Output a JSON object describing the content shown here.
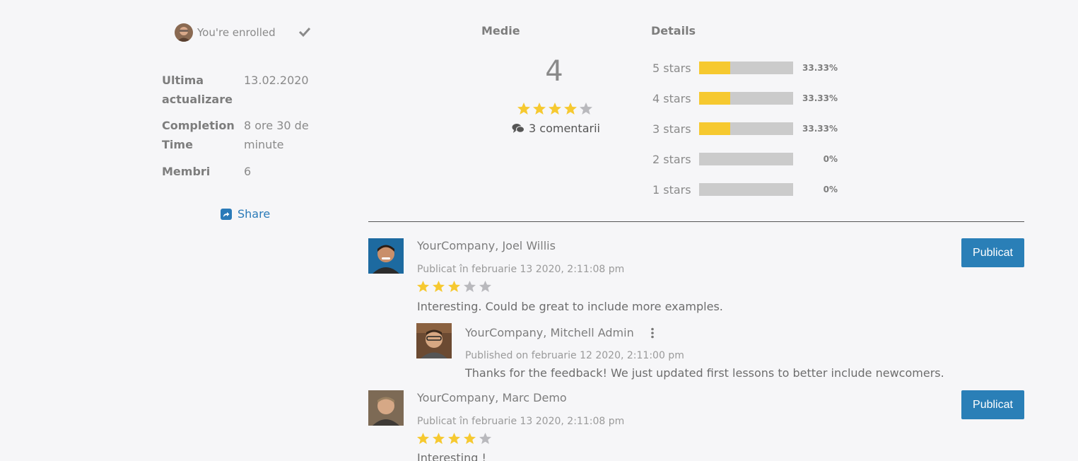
{
  "enrollment": {
    "status_text": "You're enrolled"
  },
  "course_info": [
    {
      "label": "Ultima actualizare",
      "value": "13.02.2020"
    },
    {
      "label": "Completion Time",
      "value": "8 ore 30 de minute"
    },
    {
      "label": "Membri",
      "value": "6"
    }
  ],
  "share": {
    "label": "Share"
  },
  "rating": {
    "average_heading": "Medie",
    "details_heading": "Details",
    "average_value": "4",
    "average_stars": 4,
    "max_stars": 5,
    "comments_text": "3 comentarii",
    "distribution": [
      {
        "label": "5 stars",
        "percent": 33.33,
        "percent_text": "33.33%"
      },
      {
        "label": "4 stars",
        "percent": 33.33,
        "percent_text": "33.33%"
      },
      {
        "label": "3 stars",
        "percent": 33.33,
        "percent_text": "33.33%"
      },
      {
        "label": "2 stars",
        "percent": 0,
        "percent_text": "0%"
      },
      {
        "label": "1 stars",
        "percent": 0,
        "percent_text": "0%"
      }
    ]
  },
  "reviews": [
    {
      "author": "YourCompany, Joel Willis",
      "date": "Publicat în februarie 13 2020, 2:11:08 pm",
      "stars": 3,
      "text": "Interesting. Could be great to include more examples.",
      "button_label": "Publicat",
      "reply": {
        "author": "YourCompany, Mitchell Admin",
        "date": "Published on februarie 12 2020, 2:11:00 pm",
        "text": "Thanks for the feedback! We just updated first lessons to better include newcomers."
      }
    },
    {
      "author": "YourCompany, Marc Demo",
      "date": "Publicat în februarie 13 2020, 2:11:08 pm",
      "stars": 4,
      "text": "Interesting !",
      "button_label": "Publicat"
    }
  ],
  "colors": {
    "accent": "#2a7fb7",
    "star_filled": "#f6c930",
    "star_empty": "#b9b9bd",
    "bar_empty": "#cbcbcb"
  }
}
